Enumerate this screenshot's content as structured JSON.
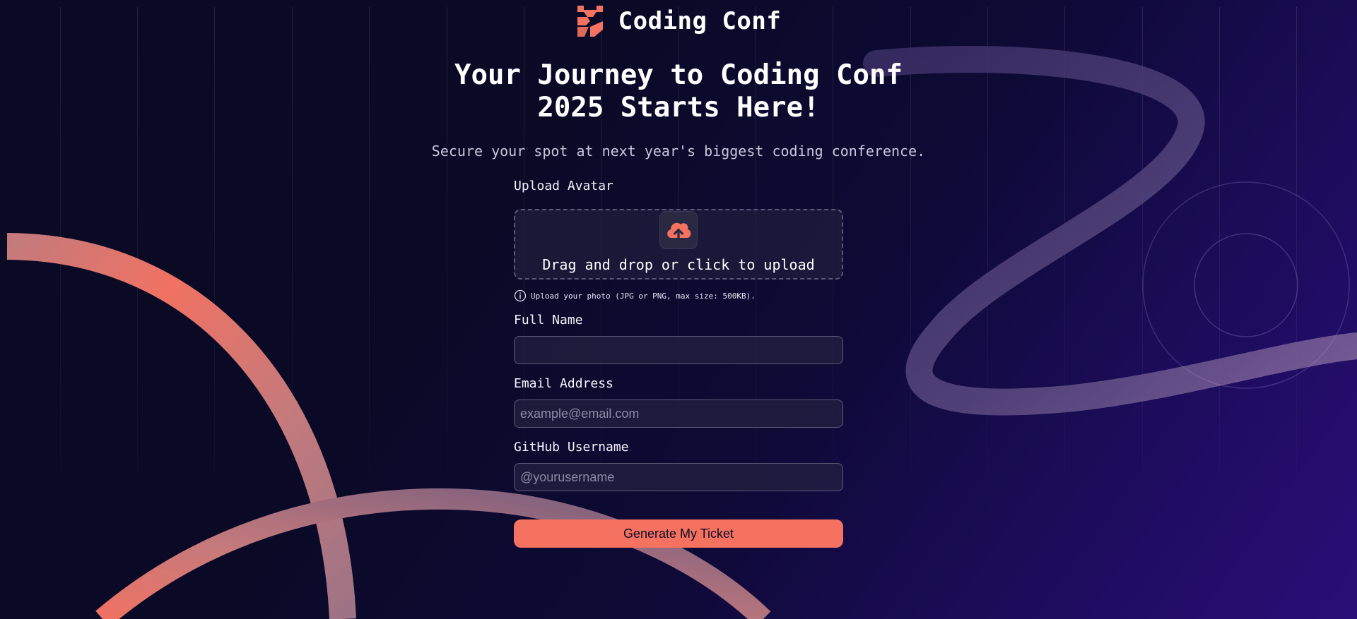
{
  "brand": {
    "name": "Coding Conf",
    "icon": "coding-conf-logo-icon",
    "accent_color": "#f57261"
  },
  "hero": {
    "headline_line1": "Your Journey to Coding Conf",
    "headline_line2": "2025 Starts Here!",
    "subheadline": "Secure your spot at next year's biggest coding conference."
  },
  "form": {
    "avatar": {
      "label": "Upload Avatar",
      "dropzone_text": "Drag and drop or click to upload",
      "icon": "cloud-upload-icon",
      "hint_icon": "info-icon",
      "hint": "Upload your photo (JPG or PNG, max size: 500KB)."
    },
    "full_name": {
      "label": "Full Name",
      "value": "",
      "placeholder": ""
    },
    "email": {
      "label": "Email Address",
      "value": "",
      "placeholder": "example@email.com"
    },
    "github": {
      "label": "GitHub Username",
      "value": "",
      "placeholder": "@yourusername"
    },
    "submit_label": "Generate My Ticket"
  }
}
